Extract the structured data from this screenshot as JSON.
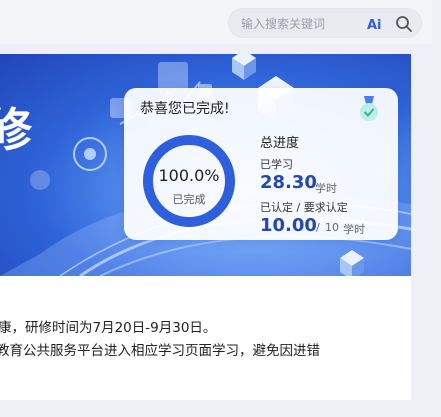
{
  "search": {
    "placeholder": "输入搜索关键词",
    "ai_label": "Ai"
  },
  "card": {
    "title": "恭喜您已完成!",
    "percent": "100.0%",
    "percent_value": 1.0,
    "percent_label": "已完成",
    "progress_title": "总进度",
    "learned_label": "已学习",
    "learned_value": "28.30",
    "learned_unit": "学时",
    "cert_label": "已认定 / 要求认定",
    "cert_value": "10.00",
    "cert_sep": "/",
    "cert_required": "10",
    "cert_unit": "学时"
  },
  "banner": {
    "partial_title": "修"
  },
  "notice": {
    "line1": "康，研修时间为7月20日-9月30日。",
    "line2": "教育公共服务平台进入相应学习页面学习，避免因进错"
  },
  "colors": {
    "accent": "#2f5fdc",
    "value_blue": "#2348b4",
    "banner_blue": "#2f63d8"
  }
}
